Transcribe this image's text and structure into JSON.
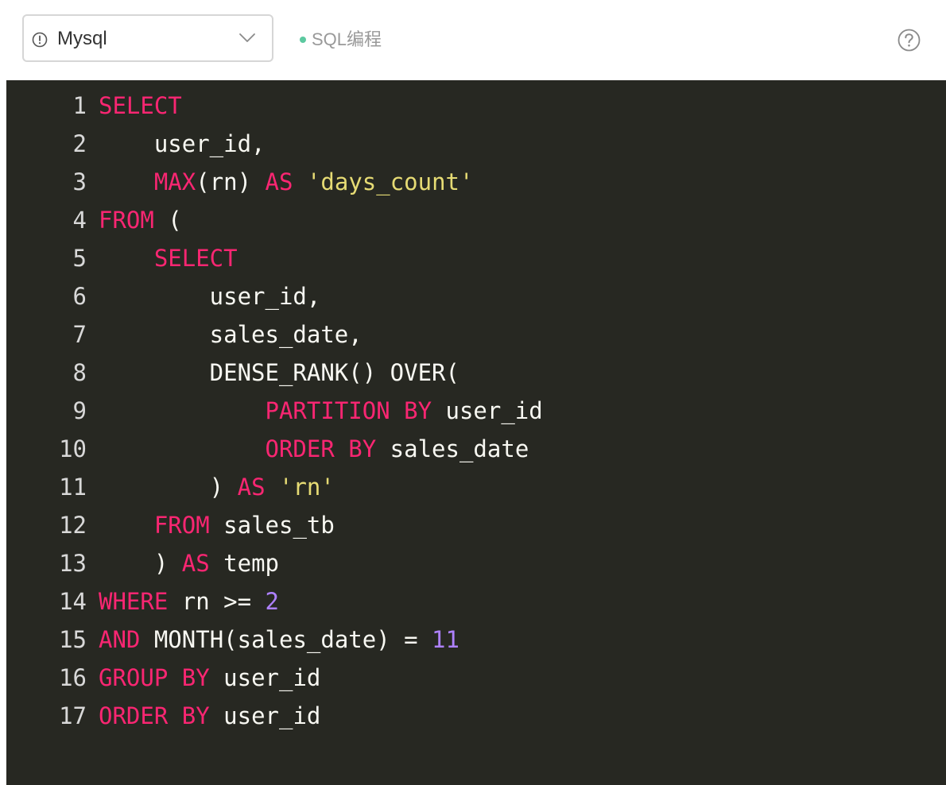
{
  "toolbar": {
    "language": "Mysql",
    "mode": "SQL编程"
  },
  "editor": {
    "lines": [
      {
        "n": "1",
        "tokens": [
          {
            "t": "SELECT",
            "c": "kw"
          }
        ]
      },
      {
        "n": "2",
        "tokens": [
          {
            "t": "    user_id,",
            "c": "plain"
          }
        ]
      },
      {
        "n": "3",
        "tokens": [
          {
            "t": "    ",
            "c": "plain"
          },
          {
            "t": "MAX",
            "c": "kw"
          },
          {
            "t": "(rn) ",
            "c": "plain"
          },
          {
            "t": "AS",
            "c": "kw"
          },
          {
            "t": " ",
            "c": "plain"
          },
          {
            "t": "'days_count'",
            "c": "str"
          }
        ]
      },
      {
        "n": "4",
        "tokens": [
          {
            "t": "FROM",
            "c": "kw"
          },
          {
            "t": " (",
            "c": "plain"
          }
        ]
      },
      {
        "n": "5",
        "tokens": [
          {
            "t": "    ",
            "c": "plain"
          },
          {
            "t": "SELECT",
            "c": "kw"
          }
        ]
      },
      {
        "n": "6",
        "tokens": [
          {
            "t": "        user_id,",
            "c": "plain"
          }
        ]
      },
      {
        "n": "7",
        "tokens": [
          {
            "t": "        sales_date,",
            "c": "plain"
          }
        ]
      },
      {
        "n": "8",
        "tokens": [
          {
            "t": "        DENSE_RANK() OVER(",
            "c": "plain"
          }
        ]
      },
      {
        "n": "9",
        "tokens": [
          {
            "t": "            ",
            "c": "plain"
          },
          {
            "t": "PARTITION",
            "c": "kw"
          },
          {
            "t": " ",
            "c": "plain"
          },
          {
            "t": "BY",
            "c": "kw"
          },
          {
            "t": " user_id",
            "c": "plain"
          }
        ]
      },
      {
        "n": "10",
        "tokens": [
          {
            "t": "            ",
            "c": "plain"
          },
          {
            "t": "ORDER",
            "c": "kw"
          },
          {
            "t": " ",
            "c": "plain"
          },
          {
            "t": "BY",
            "c": "kw"
          },
          {
            "t": " sales_date",
            "c": "plain"
          }
        ]
      },
      {
        "n": "11",
        "tokens": [
          {
            "t": "        ) ",
            "c": "plain"
          },
          {
            "t": "AS",
            "c": "kw"
          },
          {
            "t": " ",
            "c": "plain"
          },
          {
            "t": "'rn'",
            "c": "str"
          }
        ]
      },
      {
        "n": "12",
        "tokens": [
          {
            "t": "    ",
            "c": "plain"
          },
          {
            "t": "FROM",
            "c": "kw"
          },
          {
            "t": " sales_tb",
            "c": "plain"
          }
        ]
      },
      {
        "n": "13",
        "tokens": [
          {
            "t": "    ) ",
            "c": "plain"
          },
          {
            "t": "AS",
            "c": "kw"
          },
          {
            "t": " temp",
            "c": "plain"
          }
        ]
      },
      {
        "n": "14",
        "tokens": [
          {
            "t": "WHERE",
            "c": "kw"
          },
          {
            "t": " rn >= ",
            "c": "plain"
          },
          {
            "t": "2",
            "c": "num"
          }
        ]
      },
      {
        "n": "15",
        "tokens": [
          {
            "t": "AND",
            "c": "kw"
          },
          {
            "t": " MONTH(sales_date) = ",
            "c": "plain"
          },
          {
            "t": "11",
            "c": "num"
          }
        ]
      },
      {
        "n": "16",
        "tokens": [
          {
            "t": "GROUP",
            "c": "kw"
          },
          {
            "t": " ",
            "c": "plain"
          },
          {
            "t": "BY",
            "c": "kw"
          },
          {
            "t": " user_id",
            "c": "plain"
          }
        ]
      },
      {
        "n": "17",
        "tokens": [
          {
            "t": "ORDER",
            "c": "kw"
          },
          {
            "t": " ",
            "c": "plain"
          },
          {
            "t": "BY",
            "c": "kw"
          },
          {
            "t": " user_id",
            "c": "plain"
          }
        ]
      }
    ]
  }
}
